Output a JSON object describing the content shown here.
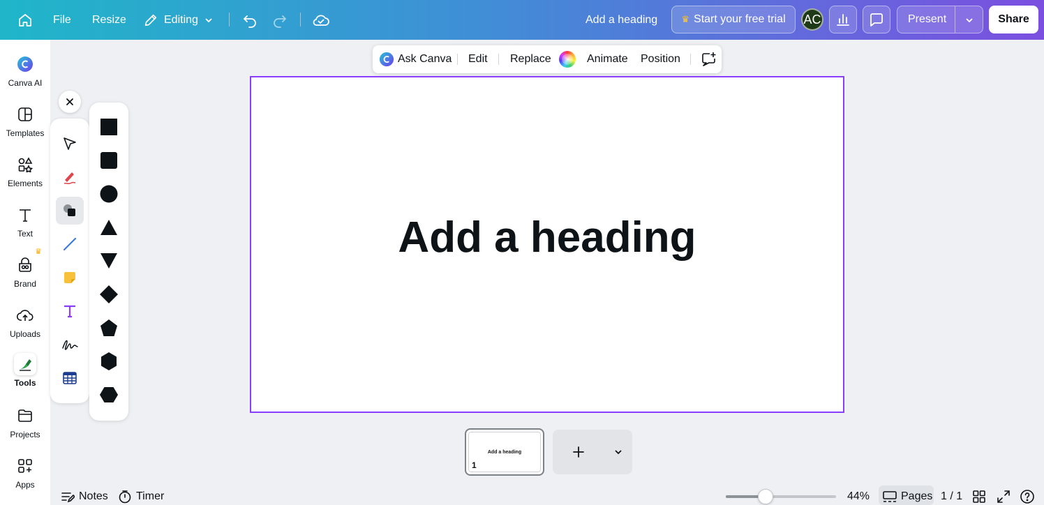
{
  "topbar": {
    "file_label": "File",
    "resize_label": "Resize",
    "editing_label": "Editing",
    "heading_title": "Add a heading",
    "trial_label": "Start your free trial",
    "avatar_initials": "AC",
    "present_label": "Present",
    "share_label": "Share",
    "gradient_start": "#1fb6c9",
    "gradient_end": "#7b4fe0"
  },
  "sidebar": {
    "items": [
      {
        "label": "Canva AI",
        "icon": "canva-ai-icon"
      },
      {
        "label": "Templates",
        "icon": "templates-icon"
      },
      {
        "label": "Elements",
        "icon": "elements-icon"
      },
      {
        "label": "Text",
        "icon": "text-icon"
      },
      {
        "label": "Brand",
        "icon": "brand-icon"
      },
      {
        "label": "Uploads",
        "icon": "uploads-icon"
      },
      {
        "label": "Tools",
        "icon": "tools-icon"
      },
      {
        "label": "Projects",
        "icon": "projects-icon"
      },
      {
        "label": "Apps",
        "icon": "apps-icon"
      }
    ]
  },
  "tools_panel": {
    "items": [
      "select-tool-icon",
      "draw-tool-icon",
      "shapes-tool-icon",
      "line-tool-icon",
      "sticky-note-tool-icon",
      "text-tool-icon",
      "signature-tool-icon",
      "table-tool-icon"
    ],
    "active": "shapes-tool-icon"
  },
  "shapes_panel": {
    "items": [
      "square-shape",
      "rounded-square-shape",
      "circle-shape",
      "triangle-shape",
      "inverted-triangle-shape",
      "diamond-shape",
      "pentagon-shape",
      "hexagon-shape",
      "horizontal-hexagon-shape"
    ]
  },
  "context_toolbar": {
    "ask_canva_label": "Ask Canva",
    "edit_label": "Edit",
    "replace_label": "Replace",
    "animate_label": "Animate",
    "position_label": "Position"
  },
  "canvas": {
    "heading": "Add a heading",
    "border_color": "#8b3dff"
  },
  "thumbnails": {
    "page_text": "Add a heading",
    "page_number": "1"
  },
  "bottombar": {
    "notes_label": "Notes",
    "timer_label": "Timer",
    "zoom_percent": "44%",
    "zoom_fraction": 0.44,
    "pages_label": "Pages",
    "page_count": "1 / 1"
  }
}
